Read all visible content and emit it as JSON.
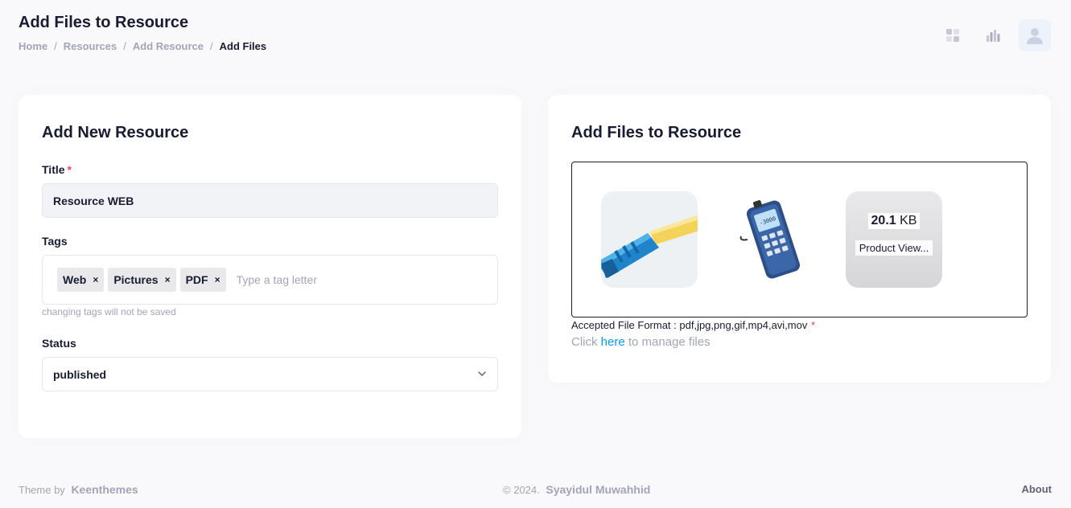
{
  "header": {
    "title": "Add Files to Resource",
    "breadcrumb": [
      {
        "label": "Home"
      },
      {
        "label": "Resources"
      },
      {
        "label": "Add Resource"
      },
      {
        "label": "Add Files"
      }
    ],
    "icons": [
      "dashboard-icon",
      "chart-icon",
      "user-avatar-icon"
    ]
  },
  "left_card": {
    "title": "Add New Resource",
    "title_label": "Title",
    "required_mark": "*",
    "title_value": "Resource WEB",
    "tags_label": "Tags",
    "tags": [
      {
        "label": "Web"
      },
      {
        "label": "Pictures"
      },
      {
        "label": "PDF"
      }
    ],
    "tag_remove": "×",
    "tag_placeholder": "Type a tag letter",
    "tags_hint": "changing tags will not be saved",
    "status_label": "Status",
    "status_value": "published"
  },
  "right_card": {
    "title": "Add Files to Resource",
    "files": [
      {
        "type": "image",
        "icon": "fiber-connector-image"
      },
      {
        "type": "image",
        "icon": "optical-power-meter-image"
      },
      {
        "type": "file",
        "size_value": "20.1",
        "size_unit": "KB",
        "name": "Product View..."
      }
    ],
    "accepted_text": "Accepted File Format : pdf,jpg,png,gif,mp4,avi,mov",
    "required_mark": "*",
    "manage_prefix": "Click",
    "manage_link": "here",
    "manage_suffix": "to manage files"
  },
  "footer": {
    "theme_by": "Theme by",
    "theme_brand": "Keenthemes",
    "copyright": "© 2024.",
    "author": "Syayidul Muwahhid",
    "about": "About"
  },
  "colors": {
    "background": "#f9f9fb",
    "text_dark": "#181c32",
    "muted": "#a1a5b7",
    "link": "#009ef7",
    "required": "#f1416c"
  }
}
